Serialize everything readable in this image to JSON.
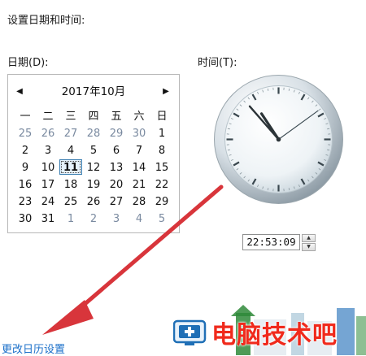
{
  "heading": "设置日期和时间:",
  "date_label": "日期(D):",
  "time_label": "时间(T):",
  "calendar": {
    "prev": "◀",
    "next": "▶",
    "month_title": "2017年10月",
    "weekdays": [
      "一",
      "二",
      "三",
      "四",
      "五",
      "六",
      "日"
    ],
    "days": [
      {
        "n": "25",
        "other": true
      },
      {
        "n": "26",
        "other": true
      },
      {
        "n": "27",
        "other": true
      },
      {
        "n": "28",
        "other": true
      },
      {
        "n": "29",
        "other": true
      },
      {
        "n": "30",
        "other": true
      },
      {
        "n": "1",
        "other": false
      },
      {
        "n": "2",
        "other": false
      },
      {
        "n": "3",
        "other": false
      },
      {
        "n": "4",
        "other": false
      },
      {
        "n": "5",
        "other": false
      },
      {
        "n": "6",
        "other": false
      },
      {
        "n": "7",
        "other": false
      },
      {
        "n": "8",
        "other": false
      },
      {
        "n": "9",
        "other": false
      },
      {
        "n": "10",
        "other": false
      },
      {
        "n": "11",
        "other": false,
        "today": true
      },
      {
        "n": "12",
        "other": false
      },
      {
        "n": "13",
        "other": false
      },
      {
        "n": "14",
        "other": false
      },
      {
        "n": "15",
        "other": false
      },
      {
        "n": "16",
        "other": false
      },
      {
        "n": "17",
        "other": false
      },
      {
        "n": "18",
        "other": false
      },
      {
        "n": "19",
        "other": false
      },
      {
        "n": "20",
        "other": false
      },
      {
        "n": "21",
        "other": false
      },
      {
        "n": "22",
        "other": false
      },
      {
        "n": "23",
        "other": false
      },
      {
        "n": "24",
        "other": false
      },
      {
        "n": "25",
        "other": false
      },
      {
        "n": "26",
        "other": false
      },
      {
        "n": "27",
        "other": false
      },
      {
        "n": "28",
        "other": false
      },
      {
        "n": "29",
        "other": false
      },
      {
        "n": "30",
        "other": false
      },
      {
        "n": "31",
        "other": false
      },
      {
        "n": "1",
        "other": true
      },
      {
        "n": "2",
        "other": true
      },
      {
        "n": "3",
        "other": true
      },
      {
        "n": "4",
        "other": true
      },
      {
        "n": "5",
        "other": true
      }
    ]
  },
  "clock": {
    "hour": 22,
    "minute": 53,
    "second": 9
  },
  "time_field": {
    "value": "22:53:09",
    "up": "▲",
    "down": "▼"
  },
  "change_calendar_link": "更改日历设置",
  "watermark": {
    "text": "电脑技术吧",
    "color": "#f02a1c"
  },
  "colors": {
    "arrow": "#d8353b",
    "link": "#1a6fc9"
  }
}
